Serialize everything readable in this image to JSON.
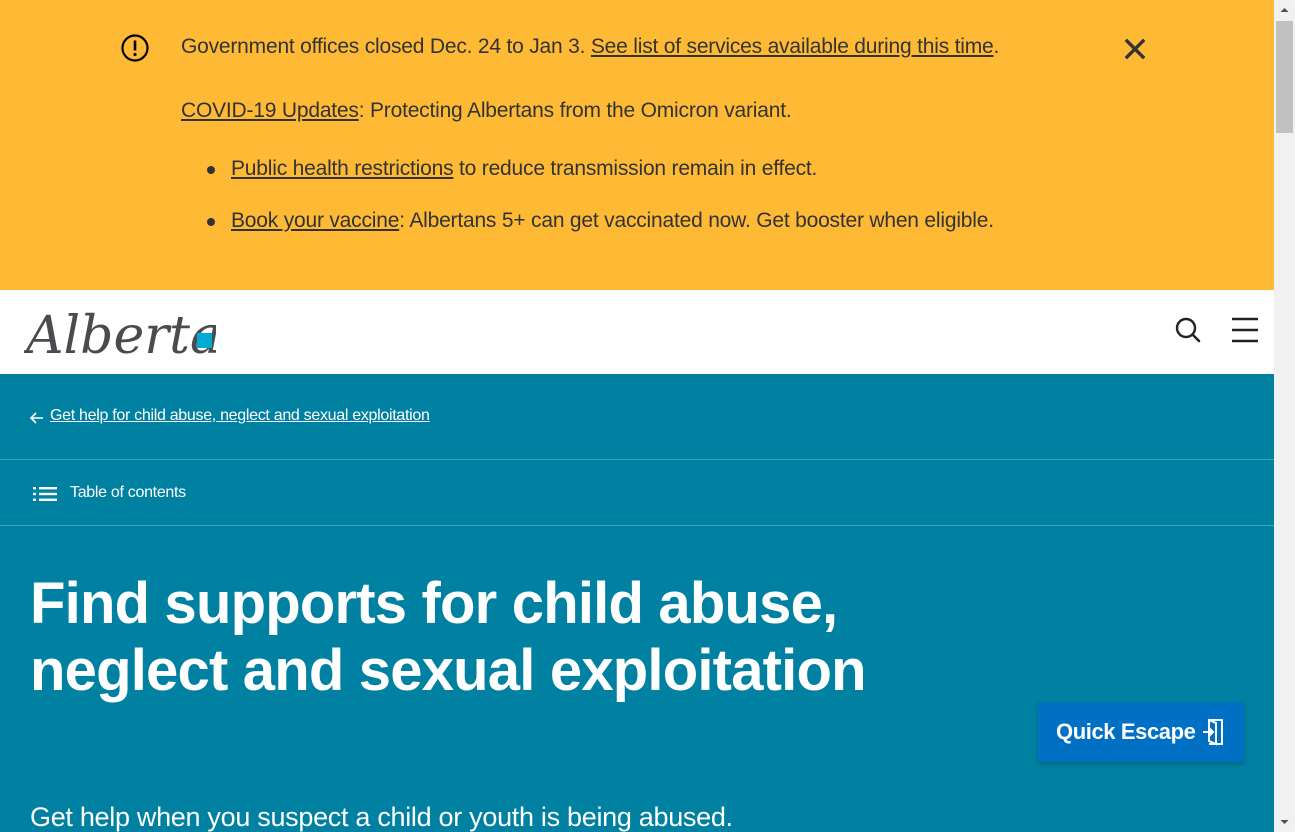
{
  "alert": {
    "line1_text": "Government offices closed Dec. 24 to Jan 3. ",
    "line1_link": "See list of services available during this time",
    "line1_end": ".",
    "line2_link": "COVID-19 Updates",
    "line2_text": ": Protecting Albertans from the Omicron variant.",
    "bullets": [
      {
        "link": "Public health restrictions",
        "text": " to reduce transmission remain in effect."
      },
      {
        "link": "Book your vaccine",
        "text": ": Albertans 5+ can get vaccinated now. Get booster when eligible."
      }
    ],
    "colors": {
      "background": "#feba35",
      "text": "#333333"
    }
  },
  "header": {
    "logo_text": "Alberta",
    "icons": [
      "search-icon",
      "menu-icon"
    ]
  },
  "breadcrumb": {
    "link": "Get help for child abuse, neglect and sexual exploitation"
  },
  "toc": {
    "label": "Table of contents"
  },
  "hero": {
    "title": "Find supports for child abuse, neglect and sexual exploitation",
    "lead": "Get help when you suspect a child or youth is being abused.",
    "colors": {
      "background": "#0081a2",
      "text": "#ffffff"
    }
  },
  "quick_escape": {
    "label": "Quick Escape",
    "color": "#0070c4"
  }
}
